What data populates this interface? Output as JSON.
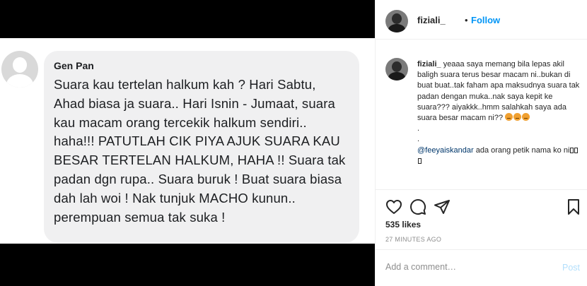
{
  "media": {
    "commenter_name": "Gen Pan",
    "comment_text": "Suara kau tertelan halkum kah ? Hari Sabtu, Ahad biasa ja suara.. Hari Isnin - Jumaat, suara kau macam orang tercekik halkum sendiri.. haha!!! PATUTLAH CIK PIYA AJUK SUARA KAU BESAR TERTELAN HALKUM, HAHA !! Suara tak padan dgn rupa.. Suara buruk ! Buat suara biasa dah lah woi ! Nak tunjuk MACHO kunun.. perempuan semua tak suka !"
  },
  "header": {
    "username": "fiziali_",
    "separator": "•",
    "follow_label": "Follow"
  },
  "caption": {
    "username": "fiziali_",
    "text": "yeaaa saya memang bila lepas akil baligh suara terus besar macam ni..bukan di buat buat..tak faham apa maksudnya suara tak padan dengan muka..nak saya kepit ke suara??? aiyakkk..hmm salahkah saya ada suara besar macam ni??",
    "dot1": ".",
    "dot2": ".",
    "mention": "@feeyaiskandar",
    "mention_text": " ada orang petik nama ko ni"
  },
  "actions": {
    "like_icon": "heart-icon",
    "comment_icon": "comment-icon",
    "share_icon": "paper-plane-icon",
    "save_icon": "bookmark-icon"
  },
  "stats": {
    "likes": "535 likes",
    "timestamp": "27 MINUTES AGO"
  },
  "comment_box": {
    "placeholder": "Add a comment…",
    "post_label": "Post"
  },
  "colors": {
    "link_blue": "#0095f6",
    "mention_blue": "#00376b",
    "post_disabled": "#b2dffc",
    "bubble_bg": "#f0f0f1"
  }
}
